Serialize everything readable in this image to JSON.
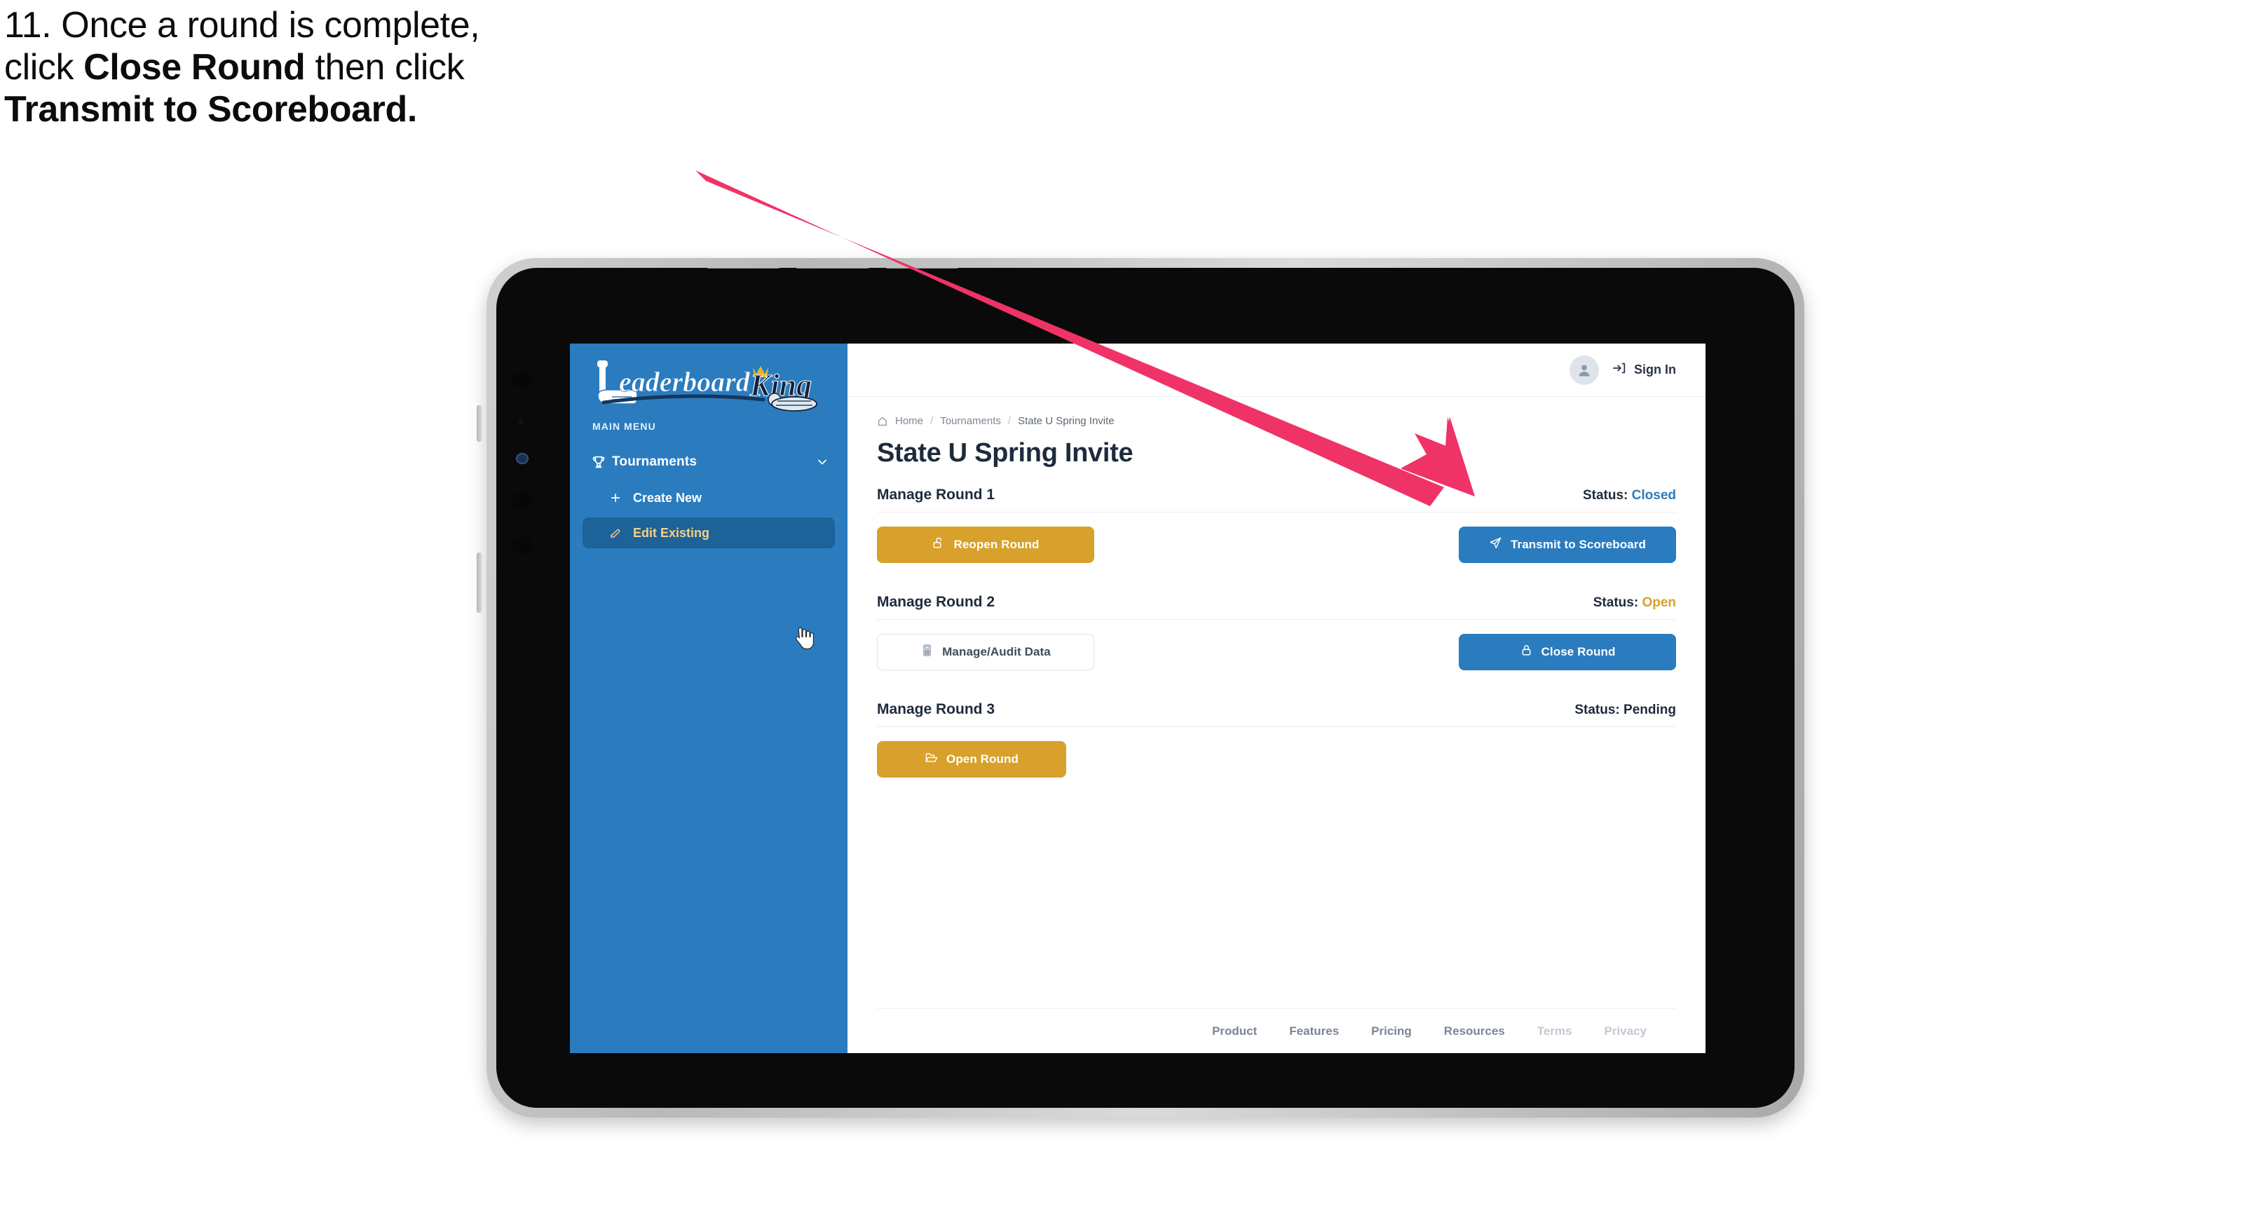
{
  "caption": {
    "line1_plain": "11. Once a round is complete,",
    "line2_pre": "click ",
    "line2_bold": "Close Round",
    "line2_post": " then click",
    "line3_bold": "Transmit to Scoreboard."
  },
  "colors": {
    "arrow": "#ef3366",
    "brand_blue": "#2a7cbf",
    "sidebar_active_bg": "#1d6298",
    "sidebar_active_text": "#f2d08a",
    "gold": "#d8a12c",
    "status_closed": "#2a7cbf",
    "status_open": "#d8a12c",
    "status_pending": "#1f2a3c",
    "text_dark": "#1f2a3c"
  },
  "sidebar": {
    "logo_text_primary": "Leaderboard",
    "logo_text_secondary": "King",
    "menu_label": "MAIN MENU",
    "nav": {
      "label": "Tournaments",
      "icon": "trophy-icon",
      "chevron": "chevron-down-icon"
    },
    "sub_items": [
      {
        "label": "Create New",
        "icon": "plus-icon",
        "active": false
      },
      {
        "label": "Edit Existing",
        "icon": "edit-pencil-icon",
        "active": true
      }
    ]
  },
  "topbar": {
    "avatar_icon": "user-avatar-icon",
    "signin_icon": "login-arrow-icon",
    "signin_label": "Sign In"
  },
  "breadcrumb": {
    "home_icon": "home-icon",
    "items": [
      "Home",
      "Tournaments",
      "State U Spring Invite"
    ],
    "separator": "/"
  },
  "page": {
    "title": "State U Spring Invite"
  },
  "rounds": [
    {
      "name": "Manage Round 1",
      "status_label": "Status:",
      "status_value": "Closed",
      "status_color": "#2a7cbf",
      "left_button": {
        "label": "Reopen Round",
        "icon": "unlock-icon",
        "style": "gold"
      },
      "right_button": {
        "label": "Transmit to Scoreboard",
        "icon": "paper-plane-icon",
        "style": "blue"
      }
    },
    {
      "name": "Manage Round 2",
      "status_label": "Status:",
      "status_value": "Open",
      "status_color": "#d8a12c",
      "left_button": {
        "label": "Manage/Audit Data",
        "icon": "calculator-icon",
        "style": "ghost"
      },
      "right_button": {
        "label": "Close Round",
        "icon": "lock-icon",
        "style": "blue"
      }
    },
    {
      "name": "Manage Round 3",
      "status_label": "Status:",
      "status_value": "Pending",
      "status_color": "#1f2a3c",
      "left_button": {
        "label": "Open Round",
        "icon": "open-folder-icon",
        "style": "gold"
      },
      "right_button": null
    }
  ],
  "footer": {
    "links": [
      {
        "label": "Product",
        "muted": false
      },
      {
        "label": "Features",
        "muted": false
      },
      {
        "label": "Pricing",
        "muted": false
      },
      {
        "label": "Resources",
        "muted": false
      },
      {
        "label": "Terms",
        "muted": true
      },
      {
        "label": "Privacy",
        "muted": true
      }
    ]
  }
}
